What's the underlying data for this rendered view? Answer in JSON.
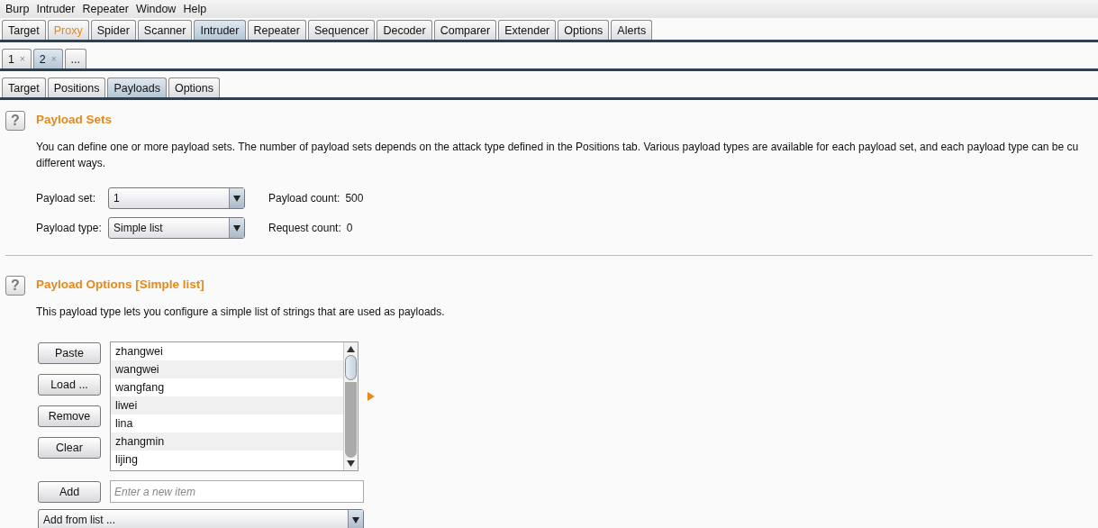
{
  "menu": [
    "Burp",
    "Intruder",
    "Repeater",
    "Window",
    "Help"
  ],
  "main_tabs": [
    {
      "label": "Target",
      "selected": false,
      "highlighted": false
    },
    {
      "label": "Proxy",
      "selected": false,
      "highlighted": true
    },
    {
      "label": "Spider",
      "selected": false,
      "highlighted": false
    },
    {
      "label": "Scanner",
      "selected": false,
      "highlighted": false
    },
    {
      "label": "Intruder",
      "selected": true,
      "highlighted": false
    },
    {
      "label": "Repeater",
      "selected": false,
      "highlighted": false
    },
    {
      "label": "Sequencer",
      "selected": false,
      "highlighted": false
    },
    {
      "label": "Decoder",
      "selected": false,
      "highlighted": false
    },
    {
      "label": "Comparer",
      "selected": false,
      "highlighted": false
    },
    {
      "label": "Extender",
      "selected": false,
      "highlighted": false
    },
    {
      "label": "Options",
      "selected": false,
      "highlighted": false
    },
    {
      "label": "Alerts",
      "selected": false,
      "highlighted": false
    }
  ],
  "attack_tabs": [
    {
      "label": "1",
      "close": "×",
      "selected": false
    },
    {
      "label": "2",
      "close": "×",
      "selected": true
    },
    {
      "label": "...",
      "selected": false
    }
  ],
  "sub_tabs": [
    {
      "label": "Target",
      "selected": false
    },
    {
      "label": "Positions",
      "selected": false
    },
    {
      "label": "Payloads",
      "selected": true
    },
    {
      "label": "Options",
      "selected": false
    }
  ],
  "payload_sets": {
    "help": "?",
    "title": "Payload Sets",
    "description_lines": [
      "You can define one or more payload sets. The number of payload sets depends on the attack type defined in the Positions tab. Various payload types are available for each payload set, and each payload type can be cu",
      "different ways."
    ],
    "payload_set": {
      "label": "Payload set:",
      "value": "1"
    },
    "payload_type": {
      "label": "Payload type:",
      "value": "Simple list"
    },
    "payload_count": {
      "label": "Payload count:",
      "value": "500"
    },
    "request_count": {
      "label": "Request count:",
      "value": "0"
    }
  },
  "payload_options": {
    "help": "?",
    "title": "Payload Options [Simple list]",
    "description": "This payload type lets you configure a simple list of strings that are used as payloads.",
    "buttons": [
      "Paste",
      "Load ...",
      "Remove",
      "Clear"
    ],
    "items": [
      "zhangwei",
      "wangwei",
      "wangfang",
      "liwei",
      "lina",
      "zhangmin",
      "lijing"
    ],
    "add_button": "Add",
    "new_item": {
      "placeholder": "Enter a new item"
    },
    "add_from_list": {
      "value": "Add from list ..."
    }
  }
}
